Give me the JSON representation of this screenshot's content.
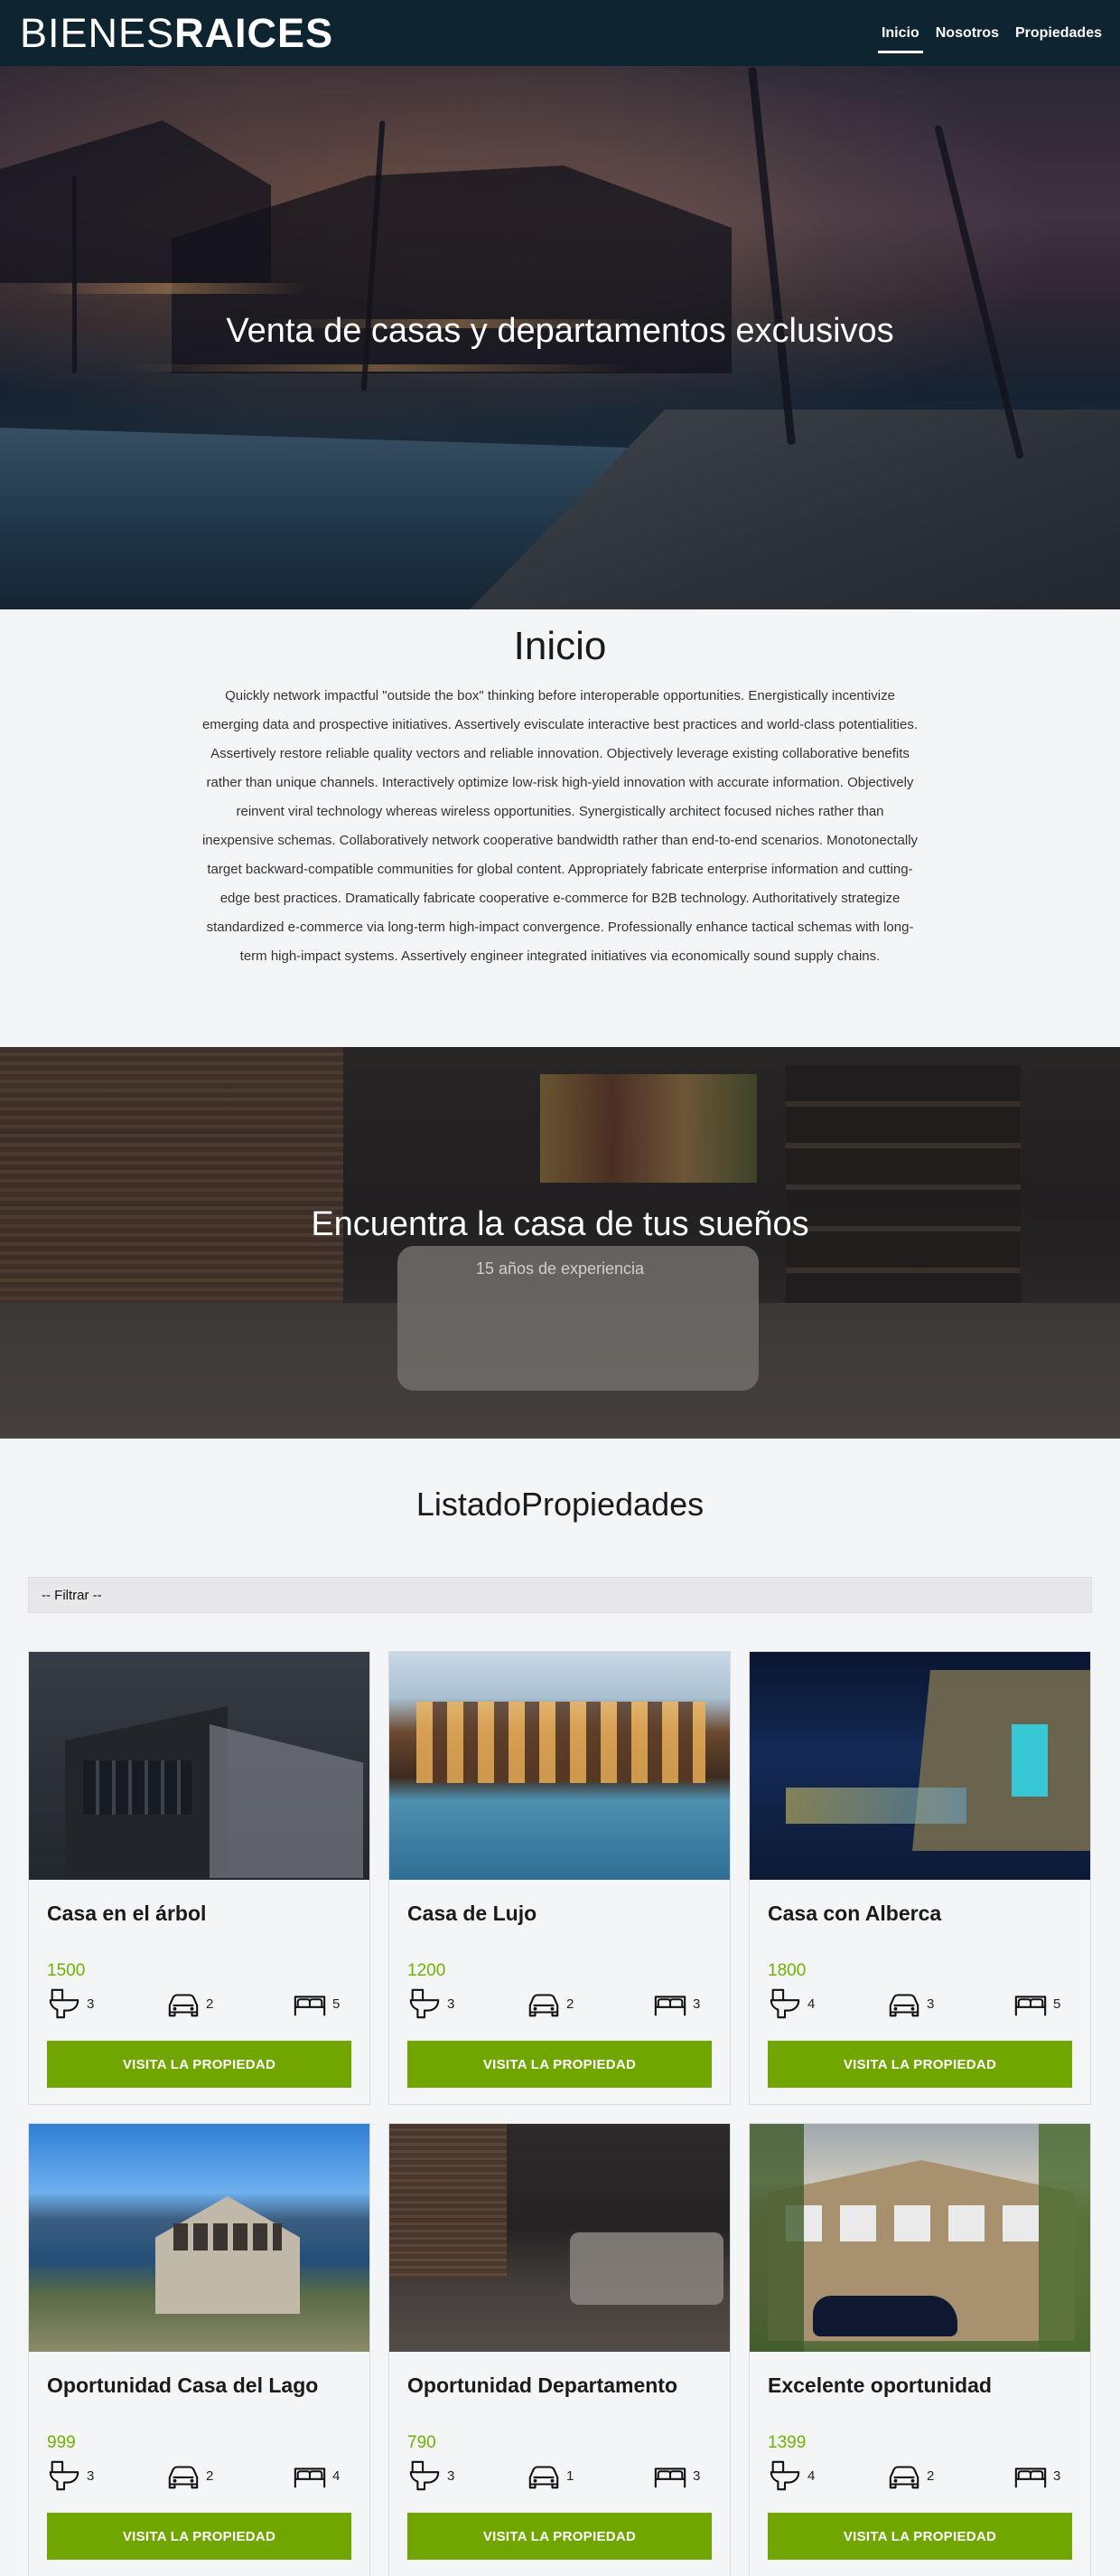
{
  "header": {
    "logo_light": "BIENES",
    "logo_bold": "RAICES",
    "nav": [
      {
        "label": "Inicio",
        "active": true
      },
      {
        "label": "Nosotros",
        "active": false
      },
      {
        "label": "Propiedades",
        "active": false
      }
    ]
  },
  "hero": {
    "title": "Venta de casas y departamentos exclusivos"
  },
  "about": {
    "title": "Inicio",
    "body": "Quickly network impactful \"outside the box\" thinking before interoperable opportunities. Energistically incentivize emerging data and prospective initiatives. Assertively evisculate interactive best practices and world-class potentialities. Assertively restore reliable quality vectors and reliable innovation. Objectively leverage existing collaborative benefits rather than unique channels. Interactively optimize low-risk high-yield innovation with accurate information. Objectively reinvent viral technology whereas wireless opportunities. Synergistically architect focused niches rather than inexpensive schemas. Collaboratively network cooperative bandwidth rather than end-to-end scenarios. Monotonectally target backward-compatible communities for global content. Appropriately fabricate enterprise information and cutting-edge best practices. Dramatically fabricate cooperative e-commerce for B2B technology. Authoritatively strategize standardized e-commerce via long-term high-impact convergence. Professionally enhance tactical schemas with long-term high-impact systems. Assertively engineer integrated initiatives via economically sound supply chains."
  },
  "banner": {
    "title": "Encuentra la casa de tus sueños",
    "subtitle": "15 años de experiencia"
  },
  "listado": {
    "title": "ListadoPropiedades",
    "filter_label": "-- Filtrar --",
    "button_label": "VISITA LA PROPIEDAD",
    "properties": [
      {
        "title": "Casa en el árbol",
        "price": "1500",
        "bathrooms": "3",
        "parking": "2",
        "bedrooms": "5",
        "image": "modern-house"
      },
      {
        "title": "Casa de Lujo",
        "price": "1200",
        "bathrooms": "3",
        "parking": "2",
        "bedrooms": "3",
        "image": "lodge-pool"
      },
      {
        "title": "Casa con Alberca",
        "price": "1800",
        "bathrooms": "4",
        "parking": "3",
        "bedrooms": "5",
        "image": "night-house"
      },
      {
        "title": "Oportunidad Casa del Lago",
        "price": "999",
        "bathrooms": "3",
        "parking": "2",
        "bedrooms": "4",
        "image": "lake-house"
      },
      {
        "title": "Oportunidad Departamento",
        "price": "790",
        "bathrooms": "3",
        "parking": "1",
        "bedrooms": "3",
        "image": "living-room"
      },
      {
        "title": "Excelente oportunidad",
        "price": "1399",
        "bathrooms": "4",
        "parking": "2",
        "bedrooms": "3",
        "image": "brick-house"
      }
    ]
  },
  "colors": {
    "header_bg": "#0e2430",
    "accent_green": "#71a600",
    "price_green": "#71b100"
  },
  "icons": [
    "toilet-icon",
    "car-icon",
    "bed-icon"
  ]
}
